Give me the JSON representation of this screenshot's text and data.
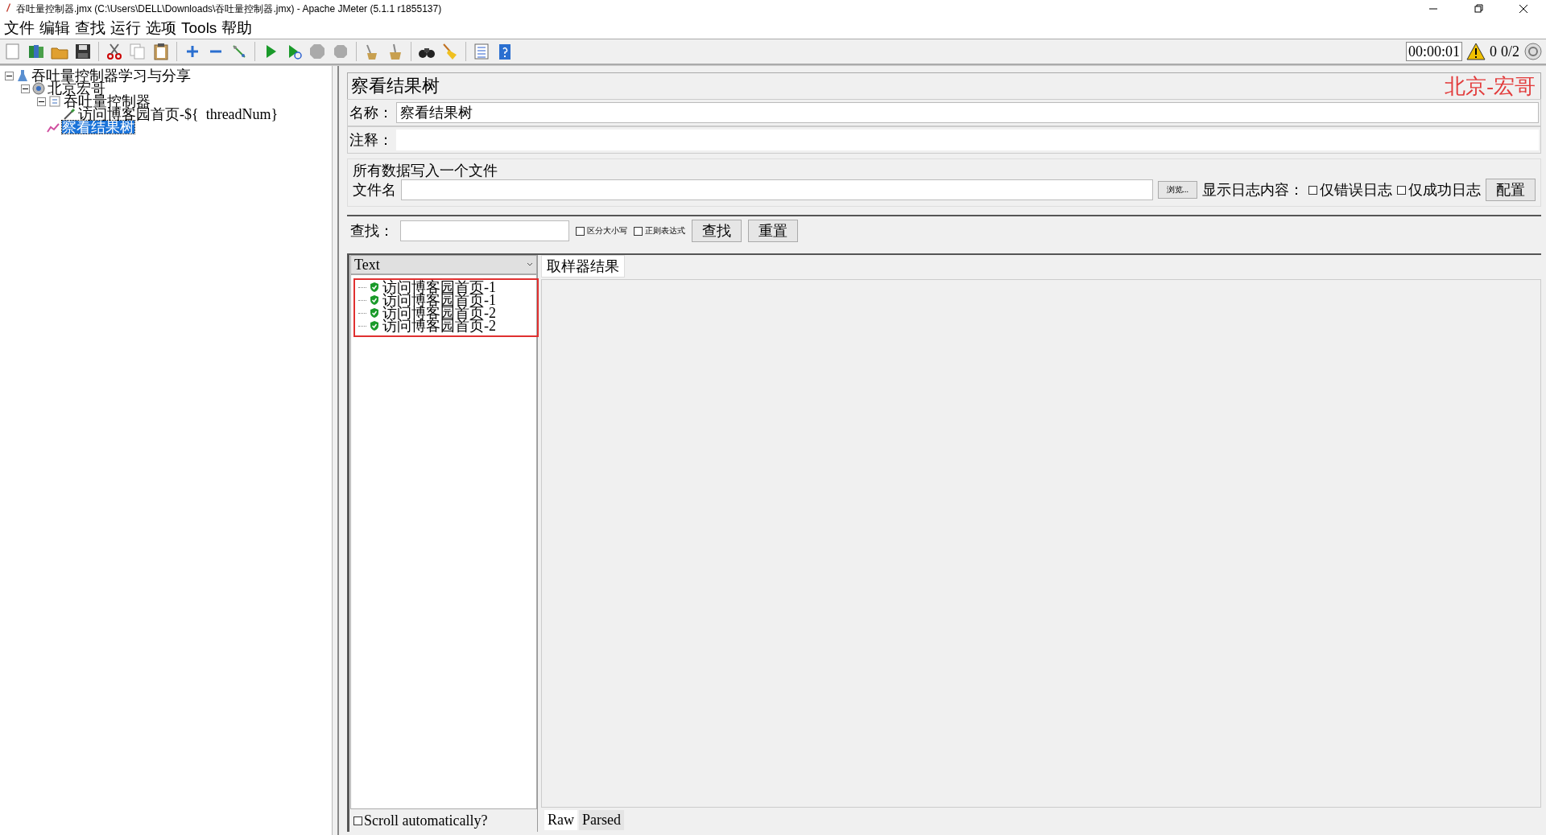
{
  "window": {
    "title": "吞吐量控制器.jmx (C:\\Users\\DELL\\Downloads\\吞吐量控制器.jmx) - Apache JMeter (5.1.1 r1855137)"
  },
  "menu": [
    "文件",
    "编辑",
    "查找",
    "运行",
    "选项",
    "Tools",
    "帮助"
  ],
  "status": {
    "timer": "00:00:01",
    "warnings": "0",
    "threads": "0/2"
  },
  "tree": [
    {
      "label": "吞吐量控制器学习与分享",
      "kind": "plan",
      "expanded": true,
      "selected": false,
      "children": [
        {
          "label": "北京宏哥",
          "kind": "threadgroup",
          "expanded": true,
          "selected": false,
          "children": [
            {
              "label": "吞吐量控制器",
              "kind": "controller",
              "expanded": true,
              "selected": false,
              "children": [
                {
                  "label": "访问博客园首页-${  threadNum}",
                  "kind": "sampler",
                  "selected": false
                }
              ]
            },
            {
              "label": "察看结果树",
              "kind": "listener",
              "selected": true
            }
          ]
        }
      ]
    }
  ],
  "panel": {
    "title": "察看结果树",
    "signature": "北京-宏哥",
    "name_label": "名称：",
    "name_value": "察看结果树",
    "comment_label": "注释：",
    "file_group": "所有数据写入一个文件",
    "file_label": "文件名",
    "browse": "浏览...",
    "log_label": "显示日志内容：",
    "log_options": [
      {
        "label": "仅错误日志",
        "checked": false
      },
      {
        "label": "仅成功日志",
        "checked": false
      }
    ],
    "config": "配置",
    "search_label": "查找：",
    "search_options": [
      {
        "label": "区分大小写",
        "checked": false
      },
      {
        "label": "正则表达式",
        "checked": false
      }
    ],
    "find": "查找",
    "reset": "重置",
    "renderer": "Text",
    "results": [
      {
        "label": "访问博客园首页-1",
        "success": true
      },
      {
        "label": "访问博客园首页-1",
        "success": true
      },
      {
        "label": "访问博客园首页-2",
        "success": true
      },
      {
        "label": "访问博客园首页-2",
        "success": true
      }
    ],
    "scroll_auto": {
      "label": "Scroll automatically?",
      "checked": false
    },
    "result_tab": "取样器结果",
    "view_tabs": [
      {
        "label": "Raw",
        "selected": true
      },
      {
        "label": "Parsed",
        "selected": false
      }
    ]
  }
}
